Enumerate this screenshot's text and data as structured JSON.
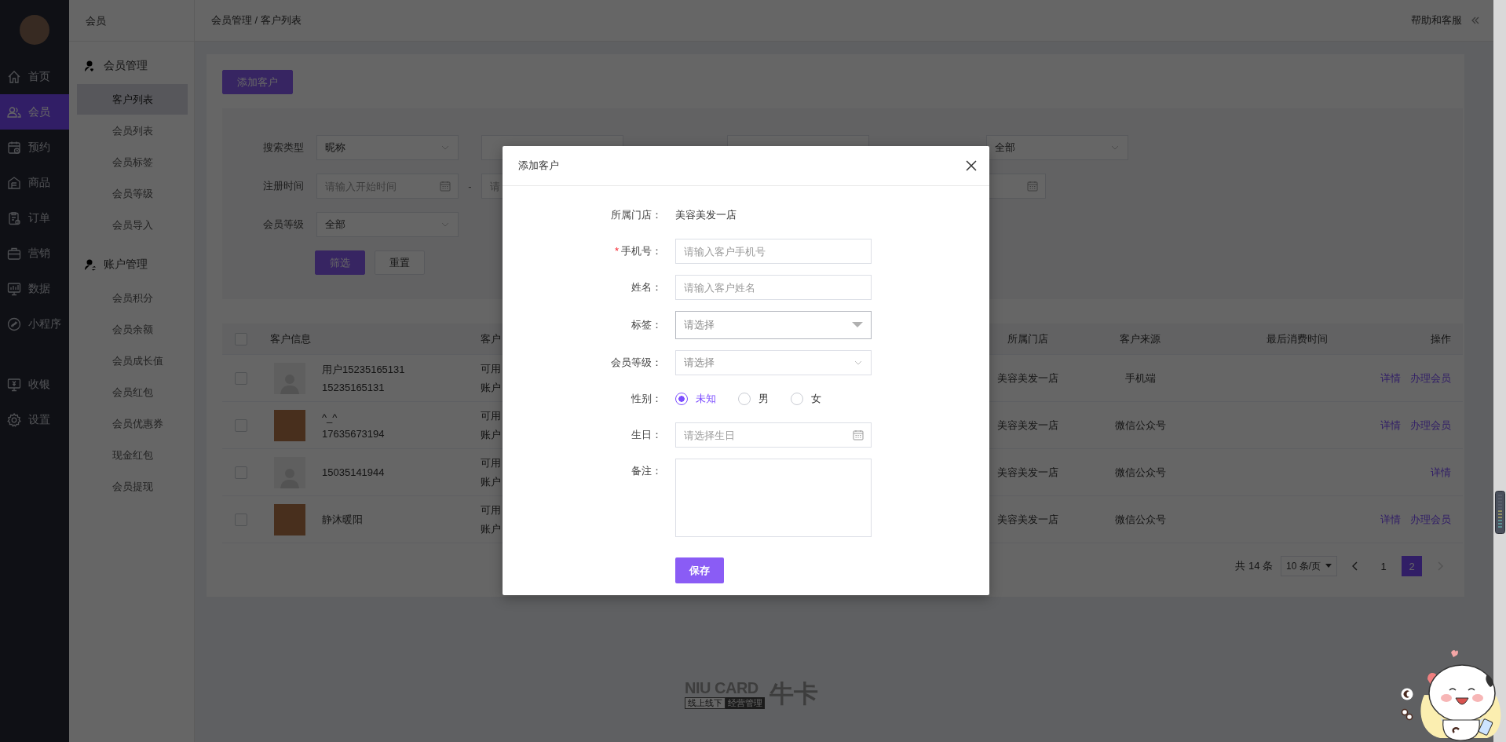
{
  "nav": {
    "main": [
      {
        "label": "首页",
        "selected": false
      },
      {
        "label": "会员",
        "selected": true
      },
      {
        "label": "预约",
        "selected": false
      },
      {
        "label": "商品",
        "selected": false
      },
      {
        "label": "订单",
        "selected": false
      },
      {
        "label": "营销",
        "selected": false
      },
      {
        "label": "数据",
        "selected": false
      },
      {
        "label": "小程序",
        "selected": false
      }
    ],
    "bottom": [
      {
        "label": "收银",
        "selected": false
      },
      {
        "label": "设置",
        "selected": false
      }
    ]
  },
  "subnav": {
    "title": "会员",
    "groups": [
      {
        "title": "会员管理",
        "items": [
          {
            "label": "客户列表",
            "selected": true
          },
          {
            "label": "会员列表",
            "selected": false
          },
          {
            "label": "会员标签",
            "selected": false
          },
          {
            "label": "会员等级",
            "selected": false
          },
          {
            "label": "会员导入",
            "selected": false
          }
        ]
      },
      {
        "title": "账户管理",
        "items": [
          {
            "label": "会员积分",
            "selected": false
          },
          {
            "label": "会员余额",
            "selected": false
          },
          {
            "label": "会员成长值",
            "selected": false
          },
          {
            "label": "会员红包",
            "selected": false
          },
          {
            "label": "会员优惠券",
            "selected": false
          },
          {
            "label": "现金红包",
            "selected": false
          },
          {
            "label": "会员提现",
            "selected": false
          }
        ]
      }
    ]
  },
  "header": {
    "breadcrumb": "会员管理 / 客户列表",
    "help": "帮助和客服"
  },
  "add_button": "添加客户",
  "filters": [
    {
      "label": "搜索类型",
      "controls": [
        {
          "kind": "select",
          "value": "昵称"
        },
        {
          "kind": "input"
        },
        {
          "kind": "select"
        },
        {
          "kind": "select",
          "value": "全部"
        }
      ]
    },
    {
      "label": "注册时间",
      "controls": [
        {
          "kind": "date",
          "placeholder": "请输入开始时间"
        },
        {
          "kind": "dash",
          "text": "-"
        },
        {
          "kind": "date",
          "placeholder": "请"
        },
        {
          "kind": "date"
        }
      ]
    },
    {
      "label": "会员等级",
      "controls": [
        {
          "kind": "select",
          "value": "全部"
        }
      ]
    }
  ],
  "filter_buttons": [
    {
      "label": "筛选",
      "kind": "primary"
    },
    {
      "label": "重置",
      "kind": "default"
    }
  ],
  "table": {
    "header_checked": false,
    "columns": [
      "客户信息",
      "客户",
      "所属门店",
      "客户来源",
      "最后消费时间",
      "操作"
    ],
    "rows": [
      {
        "checked": false,
        "kind": "default",
        "info": [
          "用户15235165131",
          "15235165131"
        ],
        "column_3": [
          "可用",
          "账户"
        ],
        "store": "美容美发一店",
        "source": "手机端",
        "actions": [
          "详情",
          "办理会员"
        ]
      },
      {
        "checked": false,
        "kind": "photo",
        "info": [
          "^_^",
          "17635673194"
        ],
        "column_3": [
          "可用",
          "账户"
        ],
        "store": "美容美发一店",
        "source": "微信公众号",
        "actions": [
          "详情",
          "办理会员"
        ]
      },
      {
        "checked": false,
        "kind": "default",
        "info": [
          "15035141944"
        ],
        "column_3": [
          "可用",
          "账户"
        ],
        "store": "美容美发一店",
        "source": "微信公众号",
        "actions": [
          "详情"
        ]
      },
      {
        "checked": false,
        "kind": "photo",
        "info": [
          "静沐暖阳"
        ],
        "column_3": [
          "可用",
          "账户"
        ],
        "store": "美容美发一店",
        "source": "微信公众号",
        "actions": [
          "详情",
          "办理会员"
        ]
      }
    ]
  },
  "pagination": {
    "total": "共 14 条",
    "page_size": "10 条/页",
    "prev_disabled": false,
    "next_disabled": true,
    "pages": [
      {
        "label": "1",
        "selected": false
      },
      {
        "label": "2",
        "selected": true
      }
    ]
  },
  "footer_logo": {
    "wordmark": "NIU CARD",
    "tag_left": "线上线下",
    "tag_right": "经营管理",
    "name": "牛卡"
  },
  "modal": {
    "title": "添加客户",
    "required_mark": "*",
    "save": "保存",
    "fields": [
      {
        "kind": "static",
        "label": "所属门店：",
        "required": false,
        "value": "美容美发一店"
      },
      {
        "kind": "input",
        "label": "手机号：",
        "required": true,
        "placeholder": "请输入客户手机号"
      },
      {
        "kind": "input",
        "label": "姓名：",
        "required": false,
        "placeholder": "请输入客户姓名"
      },
      {
        "kind": "dropdown",
        "label": "标签：",
        "required": false,
        "placeholder": "请选择"
      },
      {
        "kind": "select",
        "label": "会员等级：",
        "required": false,
        "placeholder": "请选择"
      },
      {
        "kind": "radio",
        "label": "性别：",
        "required": false,
        "options": [
          {
            "label": "未知",
            "selected": true
          },
          {
            "label": "男",
            "selected": false
          },
          {
            "label": "女",
            "selected": false
          }
        ]
      },
      {
        "kind": "date",
        "label": "生日：",
        "required": false,
        "placeholder": "请选择生日"
      },
      {
        "kind": "textarea",
        "label": "备注：",
        "required": false
      }
    ]
  }
}
